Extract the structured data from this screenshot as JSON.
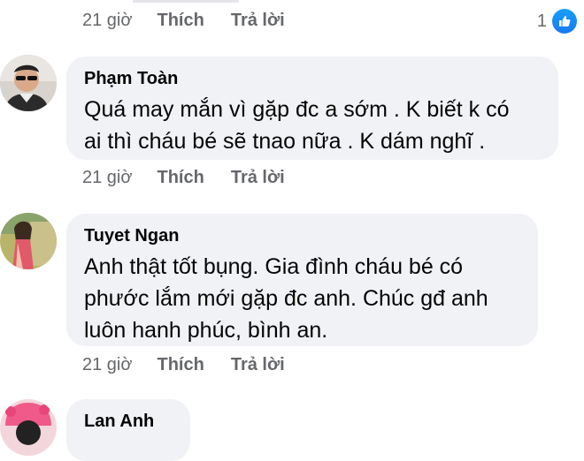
{
  "top_meta": {
    "time": "21 giờ",
    "like": "Thích",
    "reply": "Trả lời"
  },
  "top_reaction": {
    "count": "1",
    "icon": "thumbs-up-icon",
    "color": "#1877f2"
  },
  "comments": [
    {
      "name": "Phạm Toàn",
      "lines": [
        "Quá may mắn vì gặp đc a sớm . K biết k có",
        "ai thì cháu bé sẽ tnao nữa . K dám nghĩ ."
      ],
      "meta": {
        "time": "21 giờ",
        "like": "Thích",
        "reply": "Trả lời"
      }
    },
    {
      "name": "Tuyet Ngan",
      "lines": [
        "Anh thật tốt bụng. Gia đình cháu bé có",
        "phước lắm mới gặp đc anh. Chúc gđ anh",
        "luôn hanh phúc, bình an."
      ],
      "meta": {
        "time": "21 giờ",
        "like": "Thích",
        "reply": "Trả lời"
      }
    },
    {
      "name": "Lan Anh"
    }
  ]
}
